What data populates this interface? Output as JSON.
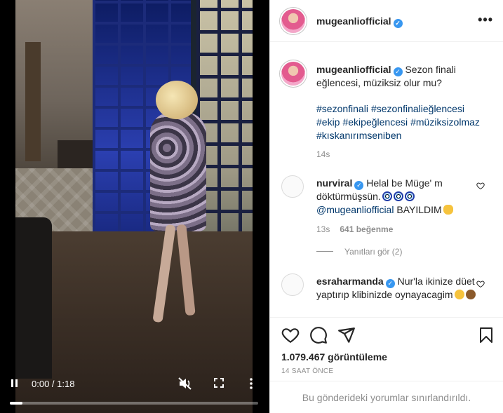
{
  "post": {
    "username": "mugeanliofficial",
    "caption": "Sezon finali eğlencesi, müziksiz olur mu?",
    "hashtags": [
      "#sezonfinali",
      "#sezonfinalieğlencesi",
      "#ekip",
      "#ekipeğlencesi",
      "#müziksizolmaz",
      "#kıskanırımseniben"
    ],
    "caption_time": "14s",
    "views": "1.079.467 görüntüleme",
    "posted": "14 SAAT ÖNCE",
    "comments_limited": "Bu gönderideki yorumlar sınırlandırıldı."
  },
  "video": {
    "time": "0:00 / 1:18",
    "progress_fraction": 0.05
  },
  "comments": [
    {
      "username": "nurviral",
      "text_a": "Helal be Müge' m döktürmüşsün.",
      "mention": "@mugeanliofficial",
      "text_b": "BAYILDIM",
      "time": "13s",
      "likes": "641 beğenme",
      "replies": "Yanıtları gör (2)"
    },
    {
      "username": "esraharmanda",
      "text_a": "Nur'la ikinize düet yaptırıp klibinizde oynayacagim"
    }
  ],
  "icons": {
    "verified": "verified-badge-icon",
    "more": "more-horizontal-icon",
    "like": "heart-icon",
    "comment": "comment-icon",
    "share": "paper-plane-icon",
    "save": "bookmark-icon",
    "mute": "muted-speaker-icon",
    "fullscreen": "fullscreen-icon",
    "play": "pause-icon"
  },
  "colors": {
    "verified": "#3897f0",
    "link": "#00376b",
    "secondary": "#8e8e8e"
  }
}
